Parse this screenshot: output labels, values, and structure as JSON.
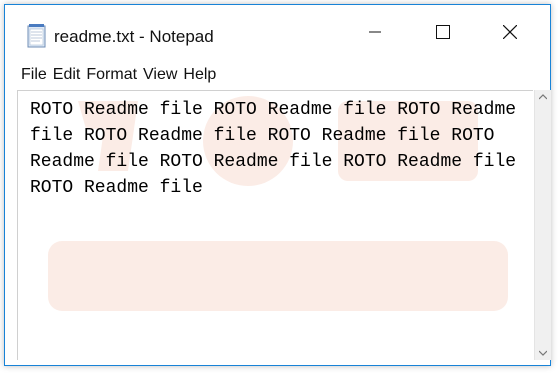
{
  "window": {
    "title": "readme.txt - Notepad"
  },
  "menu": {
    "items": [
      "File",
      "Edit",
      "Format",
      "View",
      "Help"
    ]
  },
  "editor": {
    "content": "ROTO Readme file ROTO Readme file ROTO Readme file ROTO Readme file ROTO Readme file ROTO Readme file ROTO Readme file ROTO Readme file ROTO Readme file"
  },
  "icons": {
    "app": "notepad-icon",
    "minimize": "minimize-icon",
    "maximize": "maximize-icon",
    "close": "close-icon",
    "scroll_up": "scroll-up-arrow-icon",
    "scroll_down": "scroll-down-arrow-icon"
  },
  "colors": {
    "window_border": "#1883d7",
    "watermark": "#f4c9b8"
  }
}
